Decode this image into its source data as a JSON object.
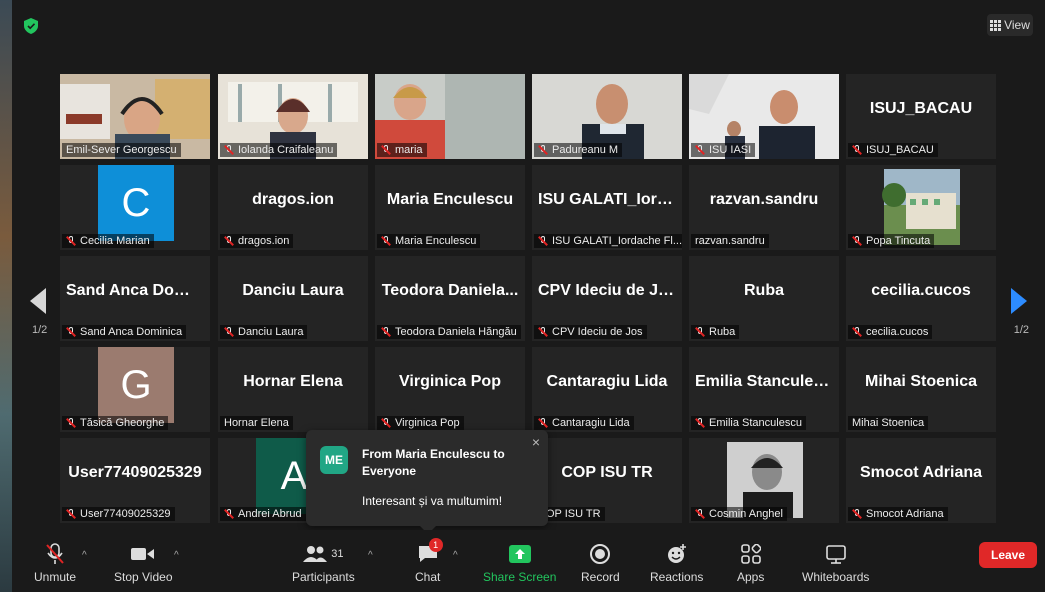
{
  "header": {
    "view_label": "View"
  },
  "pages": {
    "left": "1/2",
    "right": "1/2"
  },
  "tiles": [
    {
      "big": "",
      "label": "Emil-Sever Georgescu",
      "muted": false
    },
    {
      "big": "",
      "label": "Iolanda Craifaleanu",
      "muted": true
    },
    {
      "big": "",
      "label": "maria",
      "muted": true
    },
    {
      "big": "",
      "label": "Padureanu M",
      "muted": true
    },
    {
      "big": "",
      "label": "ISU IASI",
      "muted": true
    },
    {
      "big": "ISUJ_BACAU",
      "label": "ISUJ_BACAU",
      "muted": true
    },
    {
      "big": "",
      "label": "Cecilia Marian",
      "muted": true,
      "avatar": "C",
      "avatar_color": "#0e8fd8"
    },
    {
      "big": "dragos.ion",
      "label": "dragos.ion",
      "muted": true
    },
    {
      "big": "Maria Enculescu",
      "label": "Maria Enculescu",
      "muted": true
    },
    {
      "big": "ISU GALATI_Iord...",
      "label": "ISU GALATI_Iordache Fl...",
      "muted": true
    },
    {
      "big": "razvan.sandru",
      "label": "razvan.sandru",
      "muted": false
    },
    {
      "big": "",
      "label": "Popa Tincuta",
      "muted": true
    },
    {
      "big": "Sand Anca Domi...",
      "label": "Sand Anca Dominica",
      "muted": true
    },
    {
      "big": "Danciu Laura",
      "label": "Danciu Laura",
      "muted": true
    },
    {
      "big": "Teodora Daniela...",
      "label": "Teodora Daniela Hăngău",
      "muted": true
    },
    {
      "big": "CPV Ideciu de Jos",
      "label": "CPV Ideciu de Jos",
      "muted": true
    },
    {
      "big": "Ruba",
      "label": "Ruba",
      "muted": true
    },
    {
      "big": "cecilia.cucos",
      "label": "cecilia.cucos",
      "muted": true
    },
    {
      "big": "",
      "label": "Tăsică Gheorghe",
      "muted": true,
      "avatar": "G",
      "avatar_color": "#9b7b6f"
    },
    {
      "big": "Hornar Elena",
      "label": "Hornar Elena",
      "muted": false
    },
    {
      "big": "Virginica Pop",
      "label": "Virginica Pop",
      "muted": true
    },
    {
      "big": "Cantaragiu Lida",
      "label": "Cantaragiu Lida",
      "muted": true
    },
    {
      "big": "Emilia Stanculescu",
      "label": "Emilia Stanculescu",
      "muted": true
    },
    {
      "big": "Mihai Stoenica",
      "label": "Mihai Stoenica",
      "muted": false
    },
    {
      "big": "User77409025329",
      "label": "User77409025329",
      "muted": true
    },
    {
      "big": "",
      "label": "Andrei Abrud",
      "muted": true,
      "avatar": "A",
      "avatar_color": "#0f5b49"
    },
    {
      "big": "",
      "label": "",
      "muted": false
    },
    {
      "big": "COP ISU TR",
      "label": "COP ISU TR",
      "muted": false
    },
    {
      "big": "",
      "label": "Cosmin Anghel",
      "muted": true
    },
    {
      "big": "Smocot Adriana",
      "label": "Smocot Adriana",
      "muted": true
    }
  ],
  "chat_toast": {
    "avatar": "ME",
    "from": "From Maria Enculescu to Everyone",
    "message": "Interesant și va multumim!",
    "close": "×"
  },
  "toolbar": {
    "unmute": "Unmute",
    "stop_video": "Stop Video",
    "participants": "Participants",
    "participants_count": "31",
    "chat": "Chat",
    "chat_badge": "1",
    "share_screen": "Share Screen",
    "record": "Record",
    "reactions": "Reactions",
    "apps": "Apps",
    "whiteboards": "Whiteboards",
    "leave": "Leave"
  },
  "colors": {
    "accent": "#2d8cff",
    "share": "#22c55e",
    "leave": "#e02828",
    "speaking": "#d6e36a"
  }
}
